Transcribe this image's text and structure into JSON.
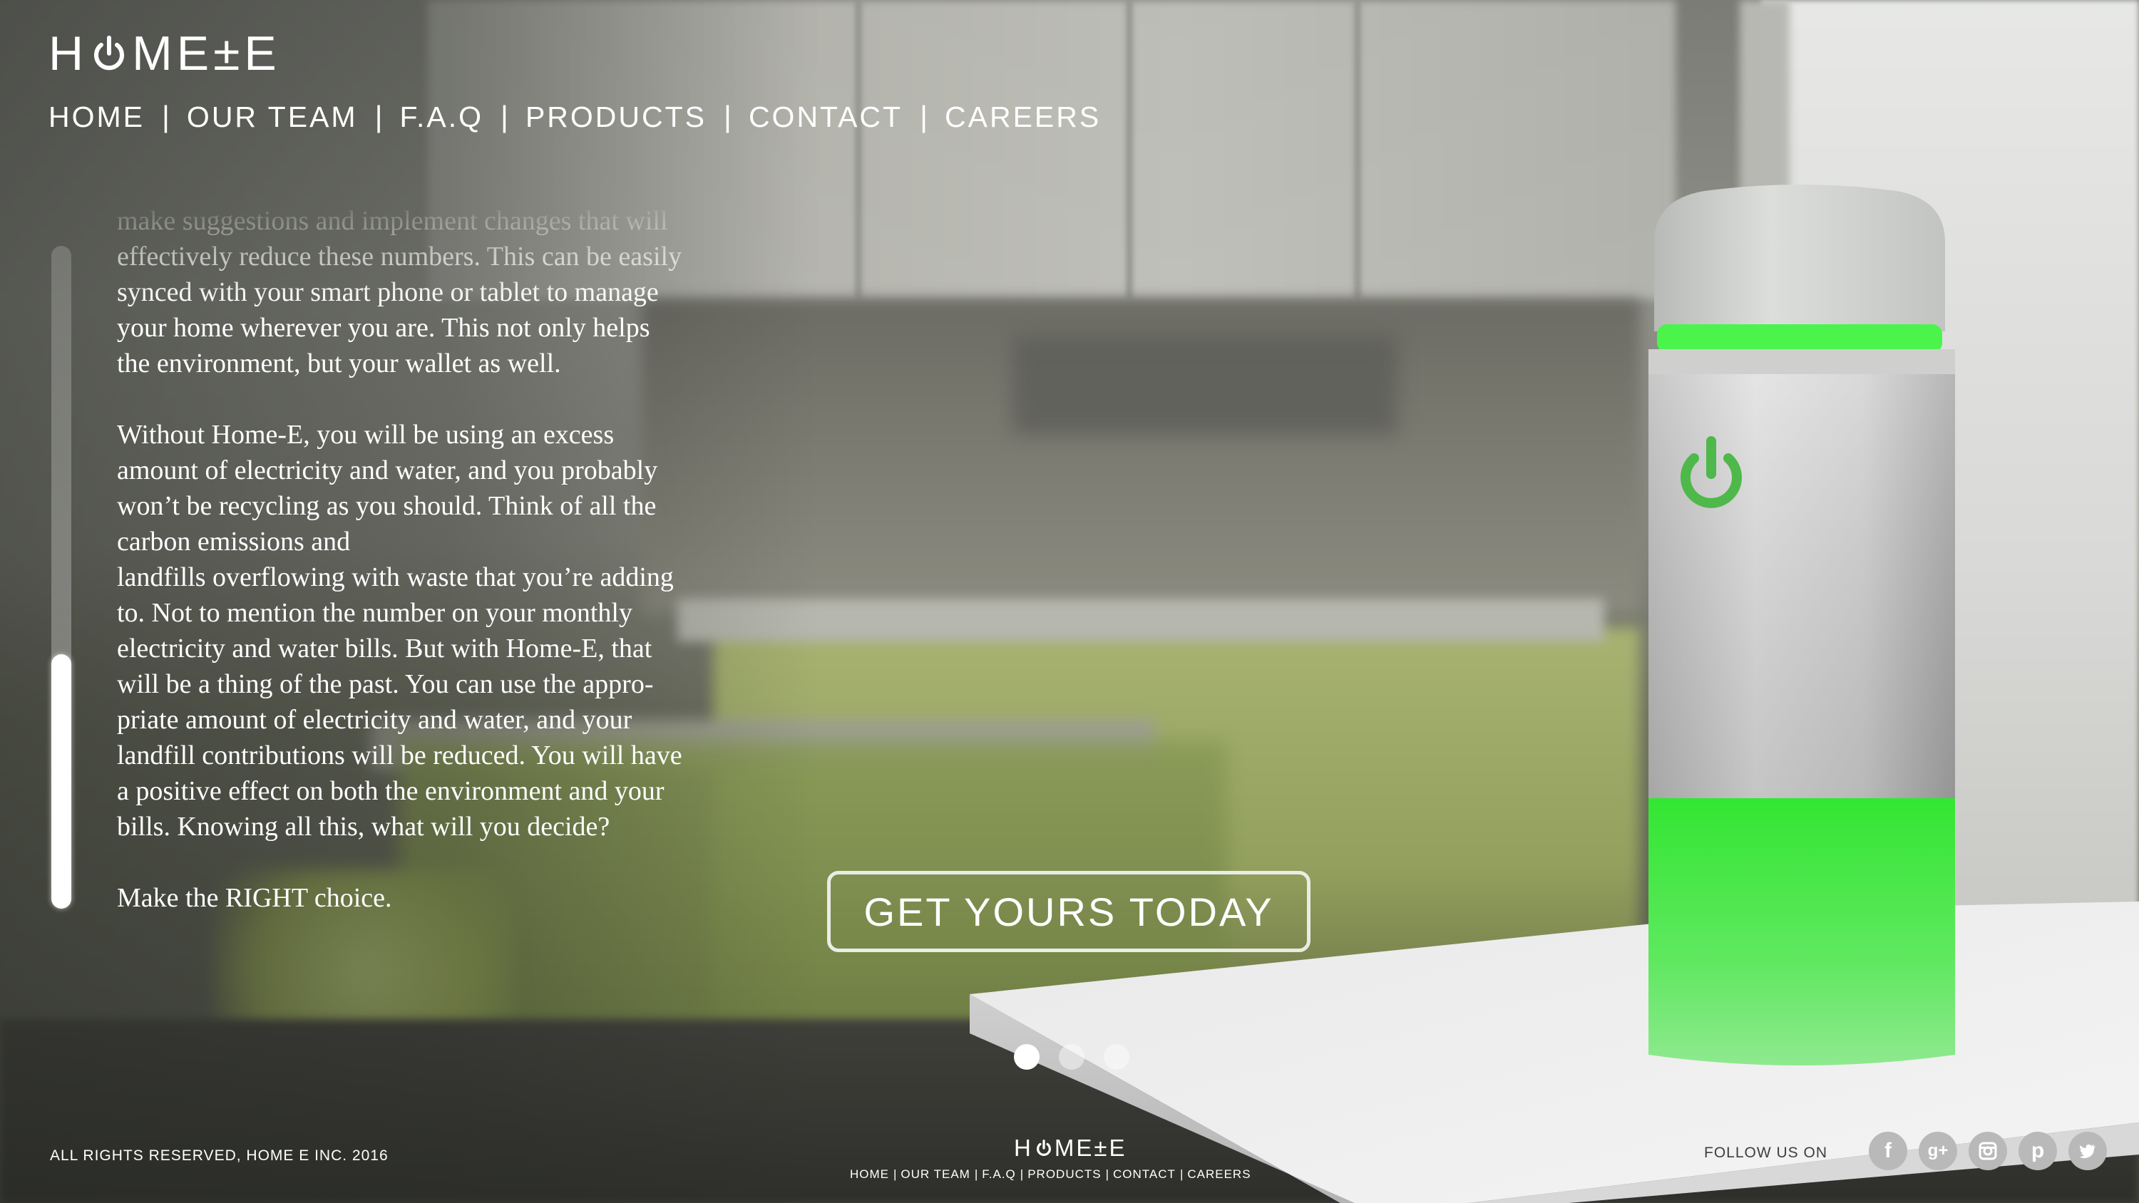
{
  "brand": {
    "logo_left": "H",
    "logo_right": "ME±E"
  },
  "nav": {
    "items": [
      {
        "label": "HOME"
      },
      {
        "label": "OUR TEAM"
      },
      {
        "label": "F.A.Q"
      },
      {
        "label": "PRODUCTS"
      },
      {
        "label": "CONTACT"
      },
      {
        "label": "CAREERS"
      }
    ],
    "separator": "|"
  },
  "article": {
    "paragraphs": [
      "make suggestions and implement changes that will\neffectively reduce these numbers. This can be easily\nsynced with your smart phone or tablet to manage\nyour home wherever you are. This not only helps\nthe environment, but your wallet as well.",
      "Without Home-E, you will be using an excess\namount of electricity and water, and you probably\nwon’t be recycling as you should. Think of all the\ncarbon emissions and\nlandfills overflowing with waste that you’re adding\nto. Not to mention the number on your monthly\nelectricity and water bills. But with Home-E, that\nwill be a thing of the past. You can use the appro-\npriate amount of electricity and water, and your\nlandfill contributions will be reduced. You will have\na positive effect on both the environment and your\nbills. Knowing all this, what will you decide?",
      "Make the RIGHT choice."
    ],
    "scroll_position": 0.62
  },
  "cta": {
    "label": "GET YOURS TODAY"
  },
  "carousel": {
    "count": 3,
    "active_index": 0
  },
  "footer": {
    "copyright": "ALL RIGHTS RESERVED, HOME E INC. 2016",
    "logo_left": "H",
    "logo_right": "ME±E",
    "nav": [
      "HOME",
      "OUR TEAM",
      "F.A.Q",
      "PRODUCTS",
      "CONTACT",
      "CAREERS"
    ],
    "separator": "|",
    "follow_label": "FOLLOW US ON",
    "socials": [
      {
        "name": "facebook",
        "glyph": "f"
      },
      {
        "name": "google-plus",
        "glyph": "g+"
      },
      {
        "name": "instagram",
        "glyph": ""
      },
      {
        "name": "pinterest",
        "glyph": "p"
      },
      {
        "name": "twitter",
        "glyph": ""
      }
    ]
  },
  "colors": {
    "accent_green": "#3ee03e",
    "power_icon_green": "#4fb84a",
    "text": "#ffffff"
  }
}
